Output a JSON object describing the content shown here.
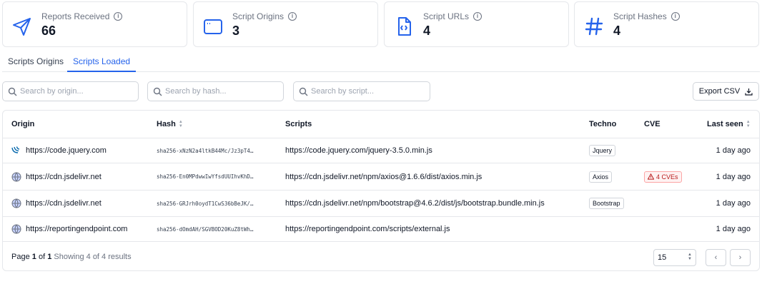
{
  "stats": [
    {
      "label": "Reports Received",
      "value": "66",
      "icon": "send-icon"
    },
    {
      "label": "Script Origins",
      "value": "3",
      "icon": "browser-window-icon"
    },
    {
      "label": "Script URLs",
      "value": "4",
      "icon": "code-file-icon"
    },
    {
      "label": "Script Hashes",
      "value": "4",
      "icon": "hash-icon"
    }
  ],
  "info_glyph": "i",
  "tabs": [
    {
      "label": "Scripts Origins",
      "active": false
    },
    {
      "label": "Scripts Loaded",
      "active": true
    }
  ],
  "search": {
    "origin_placeholder": "Search by origin...",
    "hash_placeholder": "Search by hash...",
    "script_placeholder": "Search by script..."
  },
  "export_label": "Export CSV",
  "table": {
    "headers": {
      "origin": "Origin",
      "hash": "Hash",
      "scripts": "Scripts",
      "techno": "Techno",
      "cve": "CVE",
      "last_seen": "Last seen"
    },
    "rows": [
      {
        "origin": "https://code.jquery.com",
        "origin_icon": "jquery-logo-icon",
        "hash": "sha256-xNzN2a4ltkB44Mc/Jz3pT4…",
        "script": "https://code.jquery.com/jquery-3.5.0.min.js",
        "techno": "Jquery",
        "cve": "",
        "last_seen": "1 day ago"
      },
      {
        "origin": "https://cdn.jsdelivr.net",
        "origin_icon": "globe-icon",
        "hash": "sha256-En0MPdwwIwYfsdUUIhvKhD…",
        "script": "https://cdn.jsdelivr.net/npm/axios@1.6.6/dist/axios.min.js",
        "techno": "Axios",
        "cve": "4 CVEs",
        "last_seen": "1 day ago"
      },
      {
        "origin": "https://cdn.jsdelivr.net",
        "origin_icon": "globe-icon",
        "hash": "sha256-GRJrh0oydT1CwS36bBeJK/…",
        "script": "https://cdn.jsdelivr.net/npm/bootstrap@4.6.2/dist/js/bootstrap.bundle.min.js",
        "techno": "Bootstrap",
        "cve": "",
        "last_seen": "1 day ago"
      },
      {
        "origin": "https://reportingendpoint.com",
        "origin_icon": "globe-icon",
        "hash": "sha256-dOmdAH/SGVBOD20KuZ8tWh…",
        "script": "https://reportingendpoint.com/scripts/external.js",
        "techno": "",
        "cve": "",
        "last_seen": "1 day ago"
      }
    ]
  },
  "pagination": {
    "page_prefix": "Page",
    "page_current": "1",
    "page_of": "of",
    "page_total": "1",
    "results_text": "Showing 4 of 4 results",
    "page_size": "15",
    "prev_glyph": "‹",
    "next_glyph": "›"
  },
  "colors": {
    "accent": "#2563eb",
    "border": "#e5e7eb",
    "cve_red": "#b91c1c"
  }
}
